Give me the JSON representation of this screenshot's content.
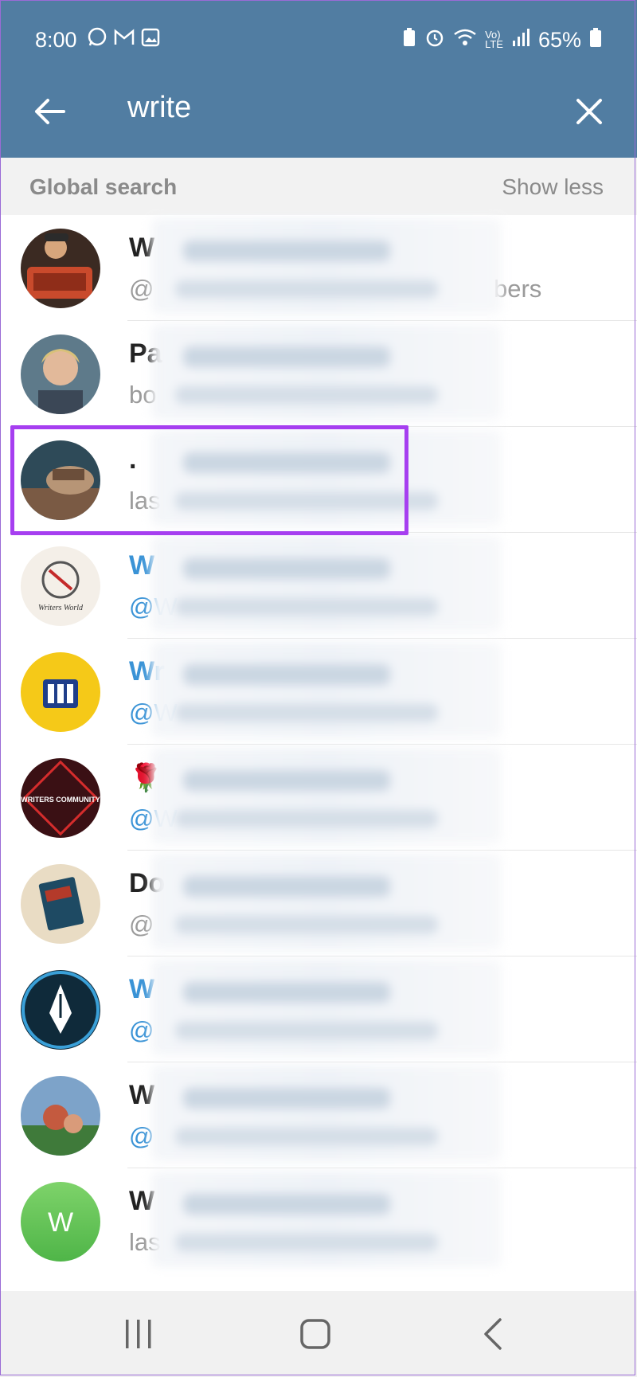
{
  "status_bar": {
    "time": "8:00",
    "battery": "65%",
    "left_icons": [
      "whatsapp-icon",
      "gmail-icon",
      "gallery-icon"
    ],
    "right_icons": [
      "battery-saver-icon",
      "alarm-icon",
      "wifi-icon",
      "volte-icon",
      "signal-icon",
      "battery-icon"
    ]
  },
  "toolbar": {
    "query": "write"
  },
  "section": {
    "title": "Global search",
    "toggle": "Show less"
  },
  "results": [
    {
      "name": "W",
      "sub": "@",
      "sub_tail": "bers",
      "name_blue": false,
      "sub_blue": false
    },
    {
      "name": "Pa",
      "sub": "bo",
      "sub_tail": "",
      "name_blue": false,
      "sub_blue": false
    },
    {
      "name": ".",
      "sub": "las",
      "sub_tail": "",
      "name_blue": false,
      "sub_blue": false
    },
    {
      "name": "W",
      "sub": "@W",
      "sub_tail": "",
      "name_blue": true,
      "sub_blue": true
    },
    {
      "name": "Wr",
      "sub": "@W",
      "sub_tail": "",
      "name_blue": true,
      "sub_blue": true
    },
    {
      "name": "🌹",
      "sub": "@W",
      "sub_tail": "",
      "name_blue": false,
      "sub_blue": true
    },
    {
      "name": "Do",
      "sub": "@",
      "sub_tail": "",
      "name_blue": false,
      "sub_blue": false
    },
    {
      "name": "W",
      "sub": "@",
      "sub_tail": "",
      "name_blue": true,
      "sub_blue": true
    },
    {
      "name": "W",
      "sub": "@",
      "sub_tail": "",
      "name_blue": false,
      "sub_blue": true
    },
    {
      "name": "W",
      "sub": "las",
      "sub_tail": "",
      "name_blue": false,
      "sub_blue": false
    }
  ],
  "avatar_letter": "W",
  "avatar_texts": [
    "Writers World",
    "WRITERS COMMUNITY"
  ],
  "colors": {
    "header": "#517da2",
    "link": "#3a93d6",
    "highlight": "#a63ff0"
  }
}
